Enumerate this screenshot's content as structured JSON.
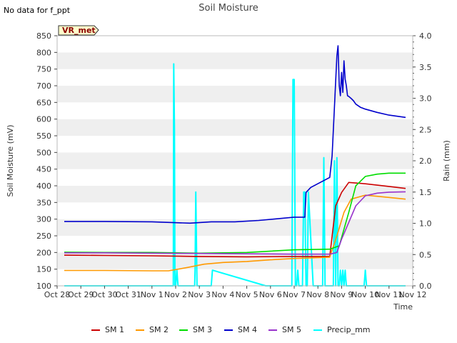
{
  "chart_data": {
    "type": "line",
    "title": "Soil Moisture",
    "note": "No data for f_ppt",
    "badge": "VR_met",
    "xlabel": "Time",
    "ylabel": "Soil Moisture (mV)",
    "y2label": "Rain (mm)",
    "xlim": [
      0,
      15
    ],
    "x_tick_labels": [
      "Oct 28",
      "Oct 29",
      "Oct 30",
      "Oct 31",
      "Nov 1",
      "Nov 2",
      "Nov 3",
      "Nov 4",
      "Nov 5",
      "Nov 6",
      "Nov 7",
      "Nov 8",
      "Nov 9",
      "Nov 10",
      "Nov 11",
      "Nov 12"
    ],
    "ylim": [
      100,
      850
    ],
    "y_ticks": [
      100,
      150,
      200,
      250,
      300,
      350,
      400,
      450,
      500,
      550,
      600,
      650,
      700,
      750,
      800,
      850
    ],
    "y2lim": [
      0.0,
      4.0
    ],
    "y2_ticks": [
      "0.0",
      "0.5",
      "1.0",
      "1.5",
      "2.0",
      "2.5",
      "3.0",
      "3.5",
      "4.0"
    ],
    "grid": "horizontal bands",
    "legend_position": "bottom",
    "series": [
      {
        "name": "SM 1",
        "color": "#cc0000",
        "axis": "left",
        "x": [
          0.3,
          2,
          4,
          6,
          8,
          10,
          11.5,
          11.75,
          12.0,
          12.3,
          13,
          14,
          14.7
        ],
        "y": [
          192,
          191,
          190,
          188,
          187,
          188,
          188,
          340,
          380,
          410,
          406,
          398,
          392
        ]
      },
      {
        "name": "SM 2",
        "color": "#ff9900",
        "axis": "left",
        "x": [
          0.3,
          2,
          4,
          4.7,
          5.5,
          6.2,
          7,
          8,
          9,
          10,
          11.5,
          11.8,
          12.1,
          12.4,
          13,
          14,
          14.7
        ],
        "y": [
          146,
          146,
          145,
          145,
          155,
          165,
          170,
          173,
          178,
          182,
          186,
          250,
          320,
          360,
          372,
          365,
          360
        ]
      },
      {
        "name": "SM 3",
        "color": "#00dd00",
        "axis": "left",
        "x": [
          0.3,
          2,
          4,
          6,
          8,
          10,
          11.5,
          11.9,
          12.3,
          12.6,
          13,
          13.5,
          14,
          14.7
        ],
        "y": [
          201,
          200,
          200,
          198,
          200,
          208,
          210,
          220,
          320,
          400,
          428,
          435,
          438,
          438
        ]
      },
      {
        "name": "SM 4",
        "color": "#0000cc",
        "axis": "left",
        "x": [
          0.3,
          2,
          4,
          5.6,
          6.5,
          7.5,
          8.5,
          10,
          10.45,
          10.5,
          10.7,
          11.5,
          11.6,
          11.8,
          11.85,
          11.9,
          11.95,
          12.0,
          12.05,
          12.1,
          12.15,
          12.2,
          12.25,
          12.3,
          12.35,
          12.4,
          12.5,
          12.6,
          12.8,
          13,
          13.5,
          14,
          14.7
        ],
        "y": [
          293,
          293,
          292,
          288,
          292,
          292,
          296,
          306,
          306,
          380,
          395,
          425,
          490,
          790,
          820,
          700,
          670,
          740,
          680,
          775,
          720,
          700,
          670,
          668,
          665,
          662,
          655,
          645,
          635,
          630,
          620,
          612,
          605
        ]
      },
      {
        "name": "SM 5",
        "color": "#9933cc",
        "axis": "left",
        "x": [
          0.3,
          2,
          4,
          6,
          8,
          10,
          11.5,
          11.8,
          12.0,
          12.3,
          12.6,
          13,
          13.5,
          14,
          14.7
        ],
        "y": [
          199,
          199,
          198,
          197,
          196,
          195,
          195,
          200,
          240,
          290,
          340,
          370,
          378,
          381,
          382
        ]
      },
      {
        "name": "Precip_mm",
        "color": "#00ffff",
        "axis": "right",
        "x": [
          0.3,
          4.9,
          4.92,
          4.95,
          4.97,
          5.0,
          5.05,
          5.1,
          5.6,
          5.8,
          5.82,
          5.85,
          5.9,
          6.5,
          6.55,
          8.8,
          9.9,
          9.95,
          10.0,
          10.05,
          10.1,
          10.15,
          10.2,
          10.3,
          10.35,
          10.4,
          10.45,
          10.5,
          10.55,
          10.6,
          10.8,
          11.2,
          11.25,
          11.3,
          11.6,
          11.65,
          11.7,
          11.75,
          11.8,
          11.85,
          11.9,
          11.95,
          12.0,
          12.05,
          12.1,
          12.15,
          12.2,
          12.25,
          12.3,
          12.35,
          12.4,
          12.45,
          12.5,
          12.55,
          12.6,
          12.7,
          12.95,
          13.0,
          13.05,
          14.7
        ],
        "y": [
          0,
          0,
          3.55,
          2.5,
          0,
          0,
          0.25,
          0,
          0,
          0,
          0.25,
          1.5,
          0,
          0,
          0.25,
          0,
          0,
          3.3,
          3.3,
          0,
          0,
          0.25,
          0,
          0,
          0,
          1.5,
          1.5,
          0,
          0,
          1.5,
          0,
          0,
          2.05,
          0,
          0,
          0,
          2.0,
          0,
          2.05,
          0,
          0,
          0.25,
          0,
          0.25,
          0,
          0.25,
          0,
          0,
          0,
          0,
          0,
          0,
          0,
          0,
          0,
          0,
          0,
          0.25,
          0,
          0
        ]
      }
    ]
  }
}
